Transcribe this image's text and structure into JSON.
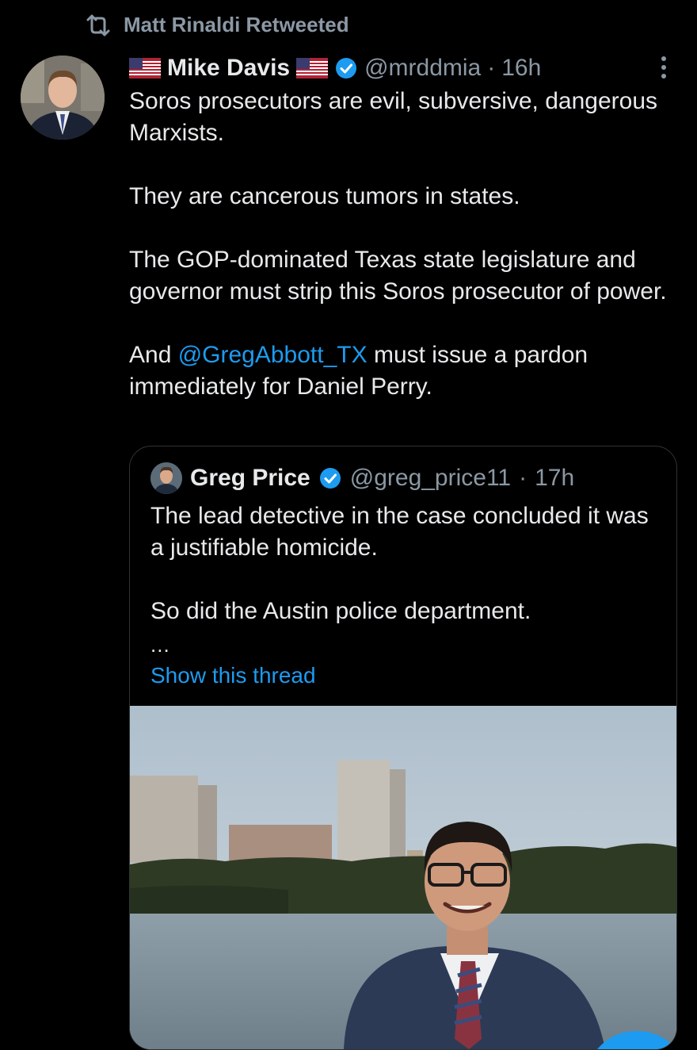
{
  "retweet": {
    "text": "Matt Rinaldi Retweeted",
    "icon": "retweet-icon"
  },
  "tweet": {
    "author_name": "Mike Davis",
    "handle": "@mrddmia",
    "separator": " · ",
    "time": "16h",
    "paragraphs": [
      "Soros prosecutors are evil, subversive, dangerous Marxists.",
      "They are cancerous tumors in states.",
      "The GOP-dominated Texas state legislature and governor must strip this Soros prosecutor of power."
    ],
    "last_paragraph": {
      "prefix": "And ",
      "mention": "@GregAbbott_TX",
      "suffix": " must issue a pardon immediately for Daniel Perry."
    }
  },
  "quote": {
    "author_name": "Greg Price",
    "handle": "@greg_price11",
    "separator": " · ",
    "time": "17h",
    "paragraphs": [
      "The lead detective in the case concluded it was a justifiable homicide.",
      "So did the Austin police department."
    ],
    "ellipsis": "...",
    "show_thread": "Show this thread"
  },
  "colors": {
    "background": "#000000",
    "text": "#e7e9ea",
    "secondary": "#8b98a5",
    "link": "#1d9bf0",
    "border": "#2f3336"
  }
}
